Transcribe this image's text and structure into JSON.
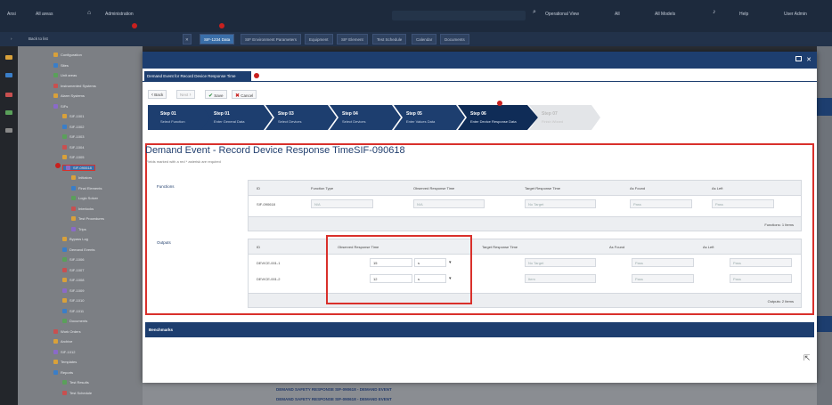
{
  "topbar": {
    "items": [
      "Ansi",
      "All areas",
      "Administration",
      "Search",
      "Operational View",
      "All",
      "All Models",
      "Help",
      "User Admin"
    ]
  },
  "subbar": {
    "back_label": "Back to list",
    "tabs": [
      "SIF-1234 Data",
      "SIF Environment Parameters",
      "Equipment",
      "SIF Element",
      "Test Schedule",
      "Calendar",
      "Documents"
    ]
  },
  "tree": {
    "rows": [
      "Configuration",
      "Sites",
      "Unit areas",
      "Instrumented Systems",
      "Alarm Systems",
      "SIFs",
      "SIF-1001",
      "SIF-1002",
      "SIF-1003",
      "SIF-1004",
      "SIF-1005",
      "SIF-090618",
      "Initiators",
      "Final Elements",
      "Logic Solver",
      "Interlocks",
      "Test Procedures",
      "Trips",
      "Bypass Log",
      "Demand Events",
      "SIF-1006",
      "SIF-1007",
      "SIF-1008",
      "SIF-1009",
      "SIF-1010",
      "SIF-1011",
      "Documents",
      "Work Orders",
      "Archive",
      "SIF-1012",
      "Templates",
      "Reports",
      "Test Results",
      "Test Schedule"
    ]
  },
  "background": {
    "links": [
      "DEMAND SAFETY RESPONSE SIF-090618 - DEMAND EVENT",
      "DEMAND SAFETY RESPONSE SIF-090618 - DEMAND EVENT"
    ]
  },
  "modal": {
    "tab_label": "Demand Event for Record Device Response Time",
    "toolbar": {
      "back": "Back",
      "next": "Next",
      "save": "Save",
      "cancel": "Cancel"
    },
    "steps": [
      {
        "title": "Step 01",
        "subtitle": "Select Function"
      },
      {
        "title": "Step 01",
        "subtitle": "Enter General Data"
      },
      {
        "title": "Step 03",
        "subtitle": "Select Devices"
      },
      {
        "title": "Step 04",
        "subtitle": "Select Devices"
      },
      {
        "title": "Step 05",
        "subtitle": "Enter Values Data"
      },
      {
        "title": "Step 06",
        "subtitle": "Enter Device Response Data"
      },
      {
        "title": "Step 07",
        "subtitle": "Finish Wizard"
      }
    ],
    "title": "Demand Event - Record Device Response TimeSIF-090618",
    "subtitle": "Fields marked with a red * asterisk are required",
    "functions": {
      "label": "Functions",
      "headers": [
        "ID",
        "Function Type",
        "Observed Response Time",
        "Target Response Time",
        "As Found",
        "As Left"
      ],
      "row": {
        "id": "SIF-090618",
        "function_type": "N/A",
        "observed": "N/A",
        "target": "No Target",
        "as_found": "Pass",
        "as_left": "Pass"
      },
      "footer": "Functions: 1 Items"
    },
    "outputs": {
      "label": "Outputs",
      "headers": [
        "ID",
        "Observed Response Time",
        "Target Response Time",
        "As Found",
        "As Left"
      ],
      "rows": [
        {
          "id": "DEVICE-001-1",
          "observed": "15",
          "unit": "s",
          "target": "No Target",
          "as_found": "Pass",
          "as_left": "Pass"
        },
        {
          "id": "DEVICE-001-2",
          "observed": "12",
          "unit": "s",
          "target": "Item",
          "as_found": "Pass",
          "as_left": "Pass"
        }
      ],
      "footer": "Outputs: 2 Items"
    },
    "benchmarks_label": "Benchmarks"
  },
  "colors": {
    "navy": "#1d3e6f",
    "highlight": "#d9302b"
  }
}
